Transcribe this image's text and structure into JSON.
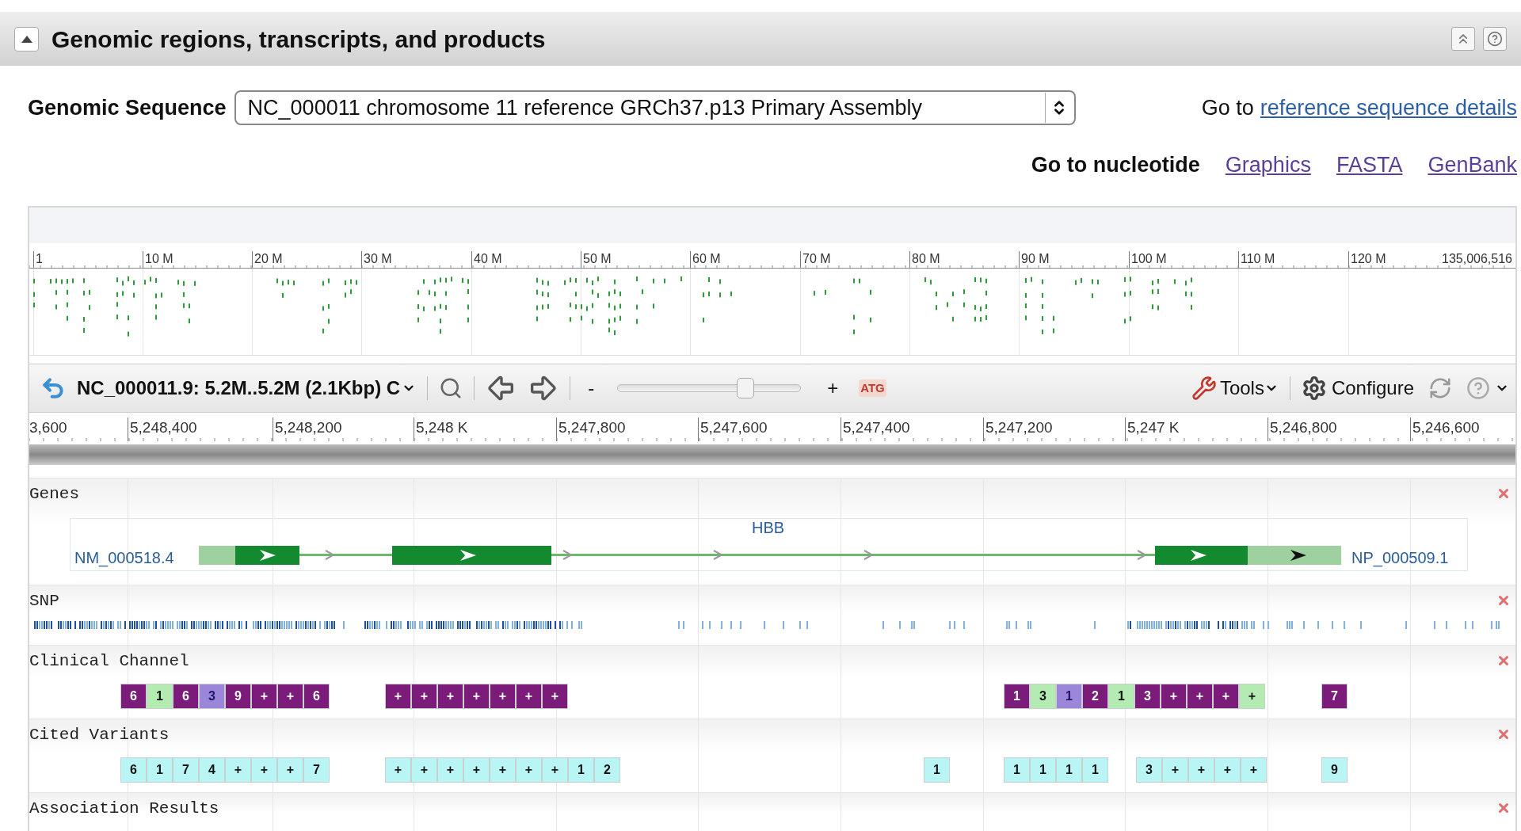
{
  "section": {
    "title": "Genomic regions, transcripts, and products",
    "expanded": true
  },
  "genomic_sequence": {
    "label": "Genomic Sequence",
    "value": "NC_000011 chromosome 11 reference GRCh37.p13 Primary Assembly"
  },
  "reference_link": {
    "prefix": "Go to",
    "link": "reference sequence details"
  },
  "nucleotide_links": {
    "label": "Go to nucleotide",
    "links": [
      "Graphics",
      "FASTA",
      "GenBank"
    ]
  },
  "overview": {
    "ticks": [
      "1",
      "10 M",
      "20 M",
      "30 M",
      "40 M",
      "50 M",
      "60 M",
      "70 M",
      "80 M",
      "90 M",
      "100 M",
      "110 M",
      "120 M"
    ],
    "end_label": "135,006,516"
  },
  "toolbar": {
    "location": "NC_000011.9: 5.2M..5.2M (2.1Kbp) C",
    "zoom_out": "-",
    "zoom": {
      "level": 0.7
    },
    "zoom_in": "+",
    "sequence_button": "ATG",
    "tools": "Tools",
    "configure": "Configure"
  },
  "ruler": {
    "ticks": [
      "3,600",
      "5,248,400",
      "5,248,200",
      "5,248 K",
      "5,247,800",
      "5,247,600",
      "5,247,400",
      "5,247,200",
      "5,247 K",
      "5,246,800",
      "5,246,600"
    ]
  },
  "tracks": [
    {
      "kind": "genes",
      "name": "Genes",
      "gene": "HBB",
      "transcript": "NM_000518.4",
      "protein": "NP_000509.1"
    },
    {
      "kind": "snp",
      "name": "SNP"
    },
    {
      "kind": "variants",
      "name": "Clinical Channel",
      "groups": [
        {
          "boxes": [
            {
              "label": "6",
              "color": "#7b1c7b"
            },
            {
              "label": "1",
              "color": "#b3ebb3"
            },
            {
              "label": "6",
              "color": "#7b1c7b"
            },
            {
              "label": "3",
              "color": "#9b86d9"
            },
            {
              "label": "9",
              "color": "#7b1c7b"
            },
            {
              "label": "+",
              "color": "#7b1c7b"
            },
            {
              "label": "+",
              "color": "#7b1c7b"
            },
            {
              "label": "6",
              "color": "#7b1c7b"
            }
          ]
        },
        {
          "boxes": [
            {
              "label": "+",
              "color": "#7b1c7b"
            },
            {
              "label": "+",
              "color": "#7b1c7b"
            },
            {
              "label": "+",
              "color": "#7b1c7b"
            },
            {
              "label": "+",
              "color": "#7b1c7b"
            },
            {
              "label": "+",
              "color": "#7b1c7b"
            },
            {
              "label": "+",
              "color": "#7b1c7b"
            },
            {
              "label": "+",
              "color": "#7b1c7b"
            }
          ]
        },
        {
          "boxes": [
            {
              "label": "1",
              "color": "#7b1c7b"
            },
            {
              "label": "3",
              "color": "#b3ebb3"
            },
            {
              "label": "1",
              "color": "#9b86d9"
            },
            {
              "label": "2",
              "color": "#7b1c7b"
            },
            {
              "label": "1",
              "color": "#b3ebb3"
            },
            {
              "label": "3",
              "color": "#7b1c7b"
            },
            {
              "label": "+",
              "color": "#7b1c7b"
            },
            {
              "label": "+",
              "color": "#7b1c7b"
            },
            {
              "label": "+",
              "color": "#7b1c7b"
            },
            {
              "label": "+",
              "color": "#b3ebb3"
            }
          ]
        },
        {
          "boxes": [
            {
              "label": "7",
              "color": "#7b1c7b"
            }
          ]
        }
      ]
    },
    {
      "kind": "variants",
      "name": "Cited Variants",
      "groups": [
        {
          "boxes": [
            {
              "label": "6",
              "color": "#b9f5f5"
            },
            {
              "label": "1",
              "color": "#b9f5f5"
            },
            {
              "label": "7",
              "color": "#b9f5f5"
            },
            {
              "label": "4",
              "color": "#b9f5f5"
            },
            {
              "label": "+",
              "color": "#b9f5f5"
            },
            {
              "label": "+",
              "color": "#b9f5f5"
            },
            {
              "label": "+",
              "color": "#b9f5f5"
            },
            {
              "label": "7",
              "color": "#b9f5f5"
            }
          ]
        },
        {
          "boxes": [
            {
              "label": "+",
              "color": "#b9f5f5"
            },
            {
              "label": "+",
              "color": "#b9f5f5"
            },
            {
              "label": "+",
              "color": "#b9f5f5"
            },
            {
              "label": "+",
              "color": "#b9f5f5"
            },
            {
              "label": "+",
              "color": "#b9f5f5"
            },
            {
              "label": "+",
              "color": "#b9f5f5"
            },
            {
              "label": "+",
              "color": "#b9f5f5"
            },
            {
              "label": "1",
              "color": "#b9f5f5"
            },
            {
              "label": "2",
              "color": "#b9f5f5"
            }
          ]
        },
        {
          "boxes": [
            {
              "label": "1",
              "color": "#b9f5f5"
            }
          ]
        },
        {
          "boxes": [
            {
              "label": "1",
              "color": "#b9f5f5"
            },
            {
              "label": "1",
              "color": "#b9f5f5"
            },
            {
              "label": "1",
              "color": "#b9f5f5"
            },
            {
              "label": "1",
              "color": "#b9f5f5"
            }
          ]
        },
        {
          "boxes": [
            {
              "label": "3",
              "color": "#b9f5f5"
            },
            {
              "label": "+",
              "color": "#b9f5f5"
            },
            {
              "label": "+",
              "color": "#b9f5f5"
            },
            {
              "label": "+",
              "color": "#b9f5f5"
            },
            {
              "label": "+",
              "color": "#b9f5f5"
            }
          ]
        },
        {
          "boxes": [
            {
              "label": "9",
              "color": "#b9f5f5"
            }
          ]
        }
      ]
    },
    {
      "kind": "empty",
      "name": "Association Results"
    }
  ]
}
